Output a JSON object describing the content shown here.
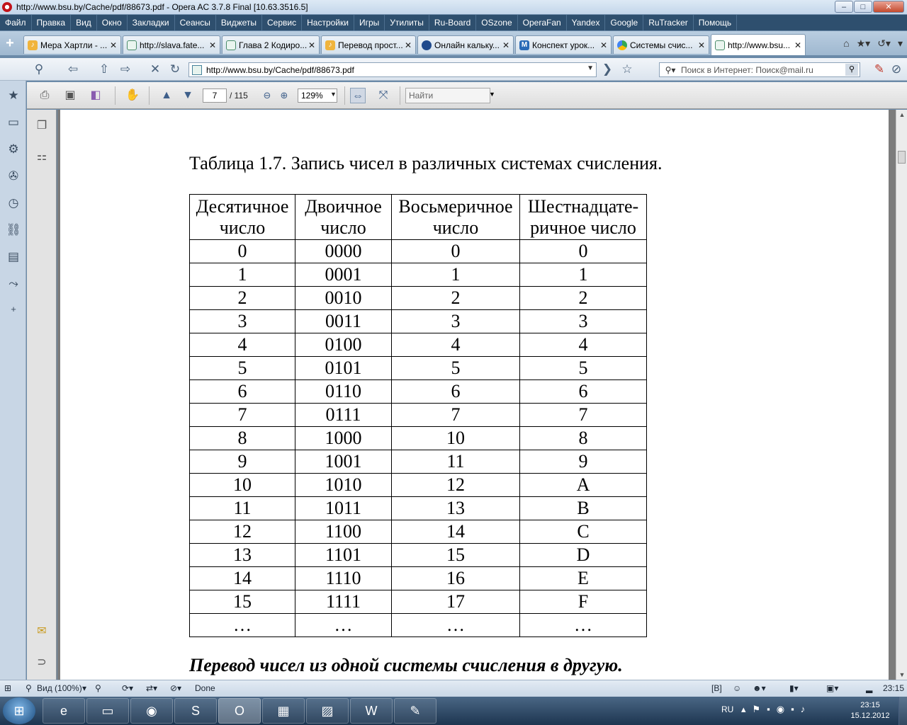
{
  "window": {
    "title": "http://www.bsu.by/Cache/pdf/88673.pdf - Opera AC 3.7.8 Final [10.63.3516.5]",
    "minimize": "–",
    "maximize": "□",
    "close": "✕"
  },
  "menu": [
    "Файл",
    "Правка",
    "Вид",
    "Окно",
    "Закладки",
    "Сеансы",
    "Виджеты",
    "Сервис",
    "Настройки",
    "Игры",
    "Утилиты",
    "Ru-Board",
    "OSzone",
    "OperaFan",
    "Yandex",
    "Google",
    "RuTracker",
    "Помощь"
  ],
  "tabs": [
    {
      "label": "Мера Хартли - ...",
      "icon": "bookmark-icon"
    },
    {
      "label": "http://slava.fate...",
      "icon": "page-icon"
    },
    {
      "label": "Глава 2 Кодиро...",
      "icon": "page-icon"
    },
    {
      "label": "Перевод прост...",
      "icon": "bookmark-icon"
    },
    {
      "label": "Онлайн кальку...",
      "icon": "globe-icon"
    },
    {
      "label": "Конспект урок...",
      "icon": "m-icon"
    },
    {
      "label": "Системы счис...",
      "icon": "google-icon"
    },
    {
      "label": "http://www.bsu...",
      "icon": "page-icon"
    }
  ],
  "address": {
    "url": "http://www.bsu.by/Cache/pdf/88673.pdf",
    "search_placeholder": "Поиск в Интернет: Поиск@mail.ru"
  },
  "pdf_toolbar": {
    "page_current": "7",
    "page_total": "/ 115",
    "zoom": "129%",
    "find_placeholder": "Найти"
  },
  "document": {
    "caption": "Таблица 1.7. Запись чисел в различных системах счисления.",
    "headers": [
      [
        "Десятичное",
        "число"
      ],
      [
        "Двоичное",
        "число"
      ],
      [
        "Восьмеричное",
        "число"
      ],
      [
        "Шестнадцате-",
        "ричное число"
      ]
    ],
    "rows": [
      [
        "0",
        "0000",
        "0",
        "0"
      ],
      [
        "1",
        "0001",
        "1",
        "1"
      ],
      [
        "2",
        "0010",
        "2",
        "2"
      ],
      [
        "3",
        "0011",
        "3",
        "3"
      ],
      [
        "4",
        "0100",
        "4",
        "4"
      ],
      [
        "5",
        "0101",
        "5",
        "5"
      ],
      [
        "6",
        "0110",
        "6",
        "6"
      ],
      [
        "7",
        "0111",
        "7",
        "7"
      ],
      [
        "8",
        "1000",
        "10",
        "8"
      ],
      [
        "9",
        "1001",
        "11",
        "9"
      ],
      [
        "10",
        "1010",
        "12",
        "A"
      ],
      [
        "11",
        "1011",
        "13",
        "B"
      ],
      [
        "12",
        "1100",
        "14",
        "C"
      ],
      [
        "13",
        "1101",
        "15",
        "D"
      ],
      [
        "14",
        "1110",
        "16",
        "E"
      ],
      [
        "15",
        "1111",
        "17",
        "F"
      ],
      [
        "…",
        "…",
        "…",
        "…"
      ]
    ],
    "heading": "Перевод чисел из одной системы счисления в другую."
  },
  "statusbar": {
    "view": "Вид (100%)",
    "done": "Done",
    "bracket_b": "[B]",
    "time": "23:15"
  },
  "taskbar": {
    "lang": "RU",
    "clock_time": "23:15",
    "clock_date": "15.12.2012"
  }
}
